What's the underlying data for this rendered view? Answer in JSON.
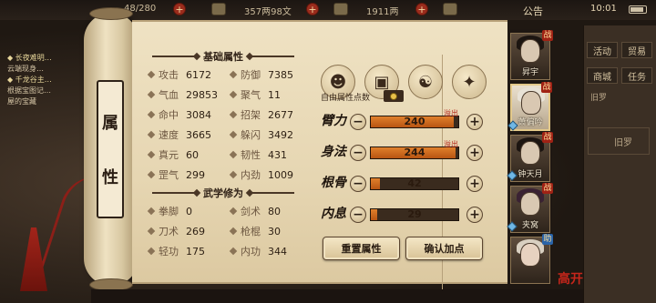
{
  "top_bar": {
    "stamina": "48/280",
    "coins": "357两98文",
    "ingots": "1911两",
    "announcement": "公告",
    "time": "10:01"
  },
  "chat_log": [
    {
      "text": "◆ 长夜难明…",
      "highlight": true
    },
    {
      "text": "云端现身…",
      "highlight": false
    },
    {
      "text": "◆ 千龙谷主…",
      "highlight": true
    },
    {
      "text": "根据宝图记…",
      "highlight": false
    },
    {
      "text": "屋的宝藏",
      "highlight": false
    }
  ],
  "title_plate": {
    "char1": "属",
    "char2": "性"
  },
  "basic_attrs": {
    "title": "基础属性",
    "items": [
      {
        "label": "攻击",
        "value": "6172"
      },
      {
        "label": "防御",
        "value": "7385"
      },
      {
        "label": "气血",
        "value": "29853"
      },
      {
        "label": "聚气",
        "value": "11"
      },
      {
        "label": "命中",
        "value": "3084"
      },
      {
        "label": "招架",
        "value": "2677"
      },
      {
        "label": "速度",
        "value": "3665"
      },
      {
        "label": "躲闪",
        "value": "3492"
      },
      {
        "label": "真元",
        "value": "60"
      },
      {
        "label": "韧性",
        "value": "431"
      },
      {
        "label": "罡气",
        "value": "299"
      },
      {
        "label": "内劲",
        "value": "1009"
      }
    ]
  },
  "martial_attrs": {
    "title": "武学修为",
    "items": [
      {
        "label": "拳脚",
        "value": "0"
      },
      {
        "label": "剑术",
        "value": "80"
      },
      {
        "label": "刀术",
        "value": "269"
      },
      {
        "label": "枪棍",
        "value": "30"
      },
      {
        "label": "轻功",
        "value": "175"
      },
      {
        "label": "内功",
        "value": "344"
      }
    ]
  },
  "free_points": {
    "label": "自由属性点数"
  },
  "growth_stats": [
    {
      "name": "臂力",
      "value": "240",
      "fill": 0.95,
      "overflow": "溢出"
    },
    {
      "name": "身法",
      "value": "244",
      "fill": 0.97,
      "overflow": "溢出"
    },
    {
      "name": "根骨",
      "value": "42",
      "fill": 0.1,
      "overflow": ""
    },
    {
      "name": "内息",
      "value": "29",
      "fill": 0.07,
      "overflow": ""
    }
  ],
  "buttons": {
    "reset": "重置属性",
    "confirm": "确认加点"
  },
  "characters": [
    {
      "name": "昇宇"
    },
    {
      "name": "萧偏吟"
    },
    {
      "name": "钟天月"
    },
    {
      "name": "夹窝"
    },
    {
      "name": ""
    }
  ],
  "side_menu": {
    "activity": "活动",
    "trade": "贸易",
    "shop": "商城",
    "task": "任务",
    "tag": "旧罗",
    "box": "旧罗",
    "recruit": "高开"
  }
}
